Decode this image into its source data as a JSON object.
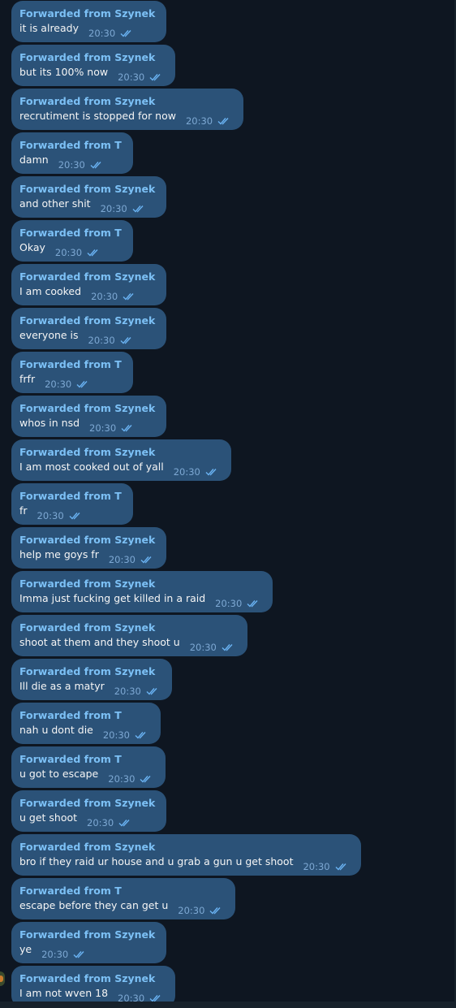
{
  "messages": [
    {
      "from": "Forwarded from Szynek",
      "text": "it is already",
      "time": "20:30"
    },
    {
      "from": "Forwarded from Szynek",
      "text": "but its 100% now",
      "time": "20:30"
    },
    {
      "from": "Forwarded from Szynek",
      "text": "recrutiment is stopped for now",
      "time": "20:30"
    },
    {
      "from": "Forwarded from T",
      "text": "damn",
      "time": "20:30"
    },
    {
      "from": "Forwarded from Szynek",
      "text": "and other shit",
      "time": "20:30"
    },
    {
      "from": "Forwarded from T",
      "text": "Okay",
      "time": "20:30"
    },
    {
      "from": "Forwarded from Szynek",
      "text": "I am cooked",
      "time": "20:30"
    },
    {
      "from": "Forwarded from Szynek",
      "text": "everyone is",
      "time": "20:30"
    },
    {
      "from": "Forwarded from T",
      "text": "frfr",
      "time": "20:30"
    },
    {
      "from": "Forwarded from Szynek",
      "text": "whos in nsd",
      "time": "20:30"
    },
    {
      "from": "Forwarded from Szynek",
      "text": "I am most cooked out of yall",
      "time": "20:30"
    },
    {
      "from": "Forwarded from T",
      "text": "fr",
      "time": "20:30"
    },
    {
      "from": "Forwarded from Szynek",
      "text": "help me goys fr",
      "time": "20:30"
    },
    {
      "from": "Forwarded from Szynek",
      "text": "Imma just fucking get killed in a raid",
      "time": "20:30"
    },
    {
      "from": "Forwarded from Szynek",
      "text": "shoot at them and they shoot u",
      "time": "20:30"
    },
    {
      "from": "Forwarded from Szynek",
      "text": "Ill die as a matyr",
      "time": "20:30"
    },
    {
      "from": "Forwarded from T",
      "text": "nah u dont die",
      "time": "20:30"
    },
    {
      "from": "Forwarded from T",
      "text": "u got to escape",
      "time": "20:30"
    },
    {
      "from": "Forwarded from Szynek",
      "text": "u get shoot",
      "time": "20:30"
    },
    {
      "from": "Forwarded from Szynek",
      "text": "bro if they raid ur house and u grab a gun u get shoot",
      "time": "20:30"
    },
    {
      "from": "Forwarded from T",
      "text": "escape before they can get u",
      "time": "20:30"
    },
    {
      "from": "Forwarded from Szynek",
      "text": "ye",
      "time": "20:30"
    },
    {
      "from": "Forwarded from Szynek",
      "text": "I am not wven 18",
      "time": "20:30"
    }
  ],
  "status_icon": "double-check-icon",
  "colors": {
    "background": "#0e1621",
    "bubble": "#2b5278",
    "forward_label": "#7cc0f5",
    "time": "#7da8d3"
  }
}
